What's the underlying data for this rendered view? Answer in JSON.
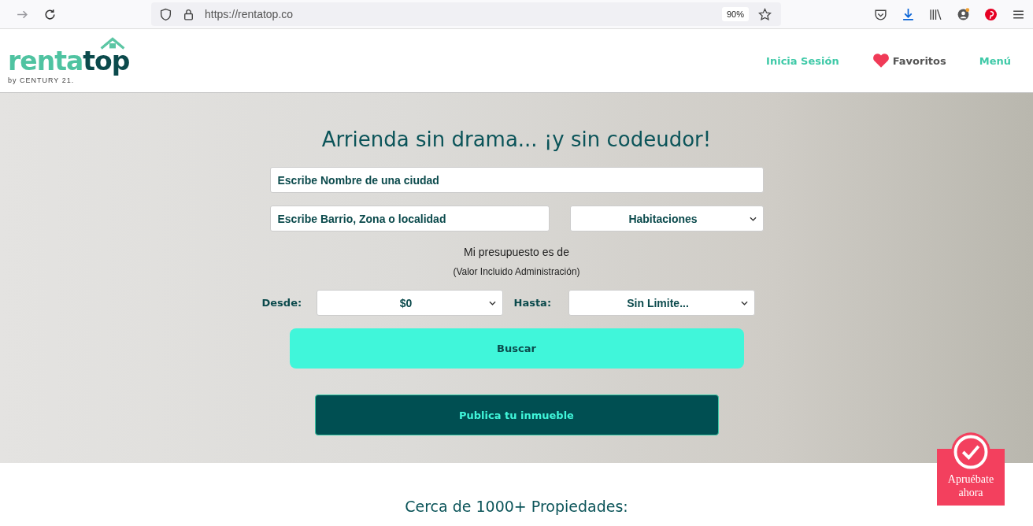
{
  "browser": {
    "url": "https://rentatop.co",
    "zoom": "90%"
  },
  "header": {
    "logo": {
      "word_light": "renta",
      "word_dark": "top",
      "tagline": "by CENTURY 21."
    },
    "nav": [
      {
        "kind": "link",
        "label": "Inicia Sesión"
      },
      {
        "kind": "favorite",
        "label": "Favoritos"
      },
      {
        "kind": "link",
        "label": "Menú"
      }
    ]
  },
  "hero": {
    "title": "Arrienda sin drama... ¡y sin codeudor!",
    "city_field": {
      "placeholder": "Escribe Nombre de una ciudad"
    },
    "area_field": {
      "placeholder": "Escribe Barrio, Zona o localidad"
    },
    "rooms_select": {
      "value": "Habitaciones"
    },
    "budget_text": "Mi presupuesto es de",
    "budget_note": "(Valor Incluido Administración)",
    "from": {
      "label": "Desde:",
      "value": "$0"
    },
    "to": {
      "label": "Hasta:",
      "value": "Sin Limite..."
    },
    "search_button": "Buscar",
    "publish_button": "Publica tu inmueble"
  },
  "listing_heading": "Cerca de 1000+ Propiedades:",
  "approve_badge": {
    "label": "Apruébate ahora"
  }
}
